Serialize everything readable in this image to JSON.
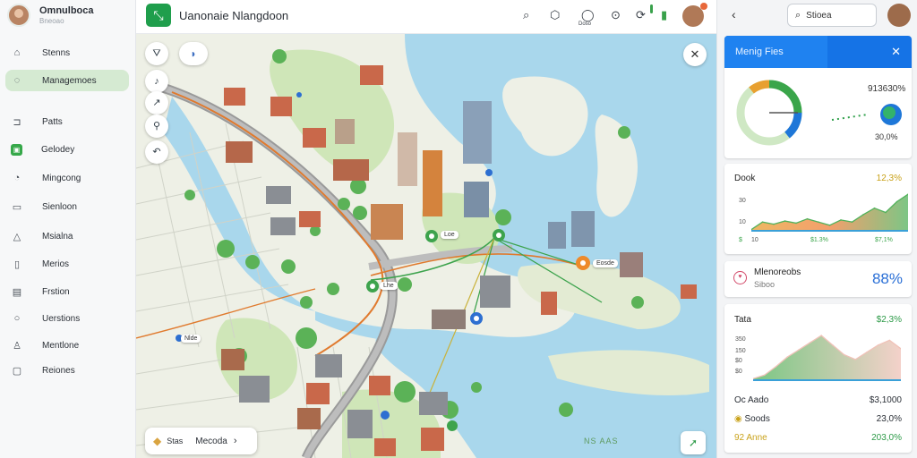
{
  "profile": {
    "name": "Omnulboca",
    "sub": "Bneoao"
  },
  "sidebar": {
    "items": [
      {
        "label": "Stenns",
        "icon": "home-icon",
        "glyph": "⌂"
      },
      {
        "label": "Managemoes",
        "icon": "layers-icon",
        "glyph": "◌"
      },
      {
        "label": "Patts",
        "icon": "paths-icon",
        "glyph": "⊐"
      },
      {
        "label": "Gelodey",
        "icon": "gallery-icon",
        "glyph": "▣"
      },
      {
        "label": "Mingcong",
        "icon": "compass-icon",
        "glyph": "◔"
      },
      {
        "label": "Sienloon",
        "icon": "document-icon",
        "glyph": "▭"
      },
      {
        "label": "Msialna",
        "icon": "terrain-icon",
        "glyph": "△"
      },
      {
        "label": "Merios",
        "icon": "clipboard-icon",
        "glyph": "▯"
      },
      {
        "label": "Frstion",
        "icon": "calendar-icon",
        "glyph": "▤"
      },
      {
        "label": "Uerstions",
        "icon": "location-icon",
        "glyph": "○"
      },
      {
        "label": "Mentlone",
        "icon": "user-icon",
        "glyph": "♙"
      },
      {
        "label": "Reiones",
        "icon": "trash-icon",
        "glyph": "▢"
      }
    ]
  },
  "topbar": {
    "title": "Uanonaie Nlangdoon",
    "badge_text": "Doso",
    "icons": [
      "search-icon",
      "shield-icon",
      "globe-icon",
      "info-icon",
      "alert-icon"
    ]
  },
  "map": {
    "legend_text1": "Stas",
    "legend_text2": "Mecoda",
    "watermark": "NS AAS",
    "labels": [
      "Loe",
      "Lhe",
      "Eosde",
      "Nlde"
    ],
    "colors": {
      "water": "#a9d7ec",
      "land": "#eef0e6",
      "park": "#cfe6b8",
      "road": "#9a9a9a",
      "route_orange": "#e07a2e",
      "route_green": "#3da34d"
    }
  },
  "panel": {
    "search_value": "Stioea",
    "card1": {
      "title": "Menig Fies",
      "value1": "913630%",
      "value2": "30,0%"
    },
    "card2": {
      "title": "Dook",
      "value": "12,3%",
      "ticks": [
        "30",
        "10"
      ],
      "footer": [
        "$",
        "10",
        "$1.3%",
        "$7,1%"
      ]
    },
    "card3": {
      "name": "Mlenoreobs",
      "sub": "Siboo",
      "value": "88%"
    },
    "card4": {
      "title": "Tata",
      "value": "$2,3%",
      "ticks": [
        "350",
        "150",
        "$0",
        "$0"
      ],
      "rows": [
        {
          "label": "Oc Aado",
          "value": "$3,1000",
          "color": "#222222"
        },
        {
          "label": "Soods",
          "value": "23,0%",
          "color": "#222222"
        },
        {
          "label": "92 Anne",
          "value": "203,0%",
          "color": "#c9a21a"
        }
      ]
    }
  },
  "chart_data": [
    {
      "type": "area",
      "title": "Dook",
      "ylabel": "",
      "series": [
        {
          "values": [
            2,
            9,
            7,
            10,
            8,
            12,
            9,
            6,
            11,
            9,
            16,
            22,
            18,
            28,
            35
          ]
        }
      ],
      "colors": [
        "#e8a030",
        "#ef7f3a",
        "#52b25c"
      ]
    },
    {
      "type": "area",
      "title": "Tata",
      "series": [
        {
          "values": [
            2,
            5,
            12,
            20,
            26,
            32,
            38,
            30,
            22,
            18,
            24,
            30,
            34,
            27
          ]
        }
      ],
      "colors": [
        "#4eb45a",
        "#f0c2b8"
      ]
    }
  ]
}
